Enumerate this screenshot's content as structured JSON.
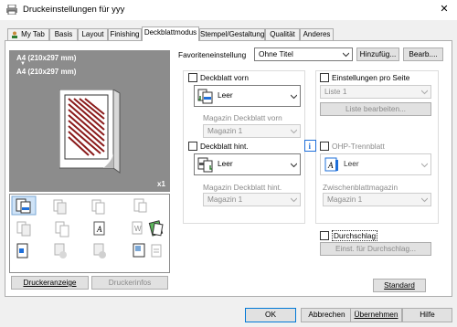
{
  "window": {
    "title": "Druckeinstellungen für yyy",
    "close_label": "✕"
  },
  "tabs": [
    "My Tab",
    "Basis",
    "Layout",
    "Finishing",
    "Deckblattmodus",
    "Stempel/Gestaltung",
    "Qualität",
    "Anderes"
  ],
  "selected_tab": "Deckblattmodus",
  "preview": {
    "paper_top": "A4 (210x297 mm)",
    "paper_arrow": "▼",
    "paper_bottom": "A4 (210x297 mm)",
    "copies": "x1"
  },
  "left_buttons": {
    "printer_display": "Druckeranzeige",
    "printer_info": "Druckerinfos"
  },
  "favorites": {
    "label": "Favoriteneinstellung",
    "value": "Ohne Titel",
    "add": "Hinzufüg...",
    "edit": "Bearb...."
  },
  "cover_front": {
    "checkbox_label": "Deckblatt vorn",
    "paper_value": "Leer",
    "tray_label": "Magazin Deckblatt vorn",
    "tray_value": "Magazin 1"
  },
  "cover_back": {
    "checkbox_label": "Deckblatt hint.",
    "paper_value": "Leer",
    "tray_label": "Magazin Deckblatt hint.",
    "tray_value": "Magazin 1"
  },
  "per_page": {
    "checkbox_label": "Einstellungen pro Seite",
    "list_value": "Liste 1",
    "edit_list": "Liste bearbeiten..."
  },
  "ohp": {
    "checkbox_label": "OHP-Trennblatt",
    "paper_value": "Leer",
    "tray_label": "Zwischenblattmagazin",
    "tray_value": "Magazin 1"
  },
  "carbon": {
    "checkbox_label": "Durchschlag",
    "settings": "Einst. für Durchschlag..."
  },
  "standard_button": "Standard",
  "dialog_buttons": {
    "ok": "OK",
    "cancel": "Abbrechen",
    "apply": "Übernehmen",
    "help": "Hilfe"
  }
}
